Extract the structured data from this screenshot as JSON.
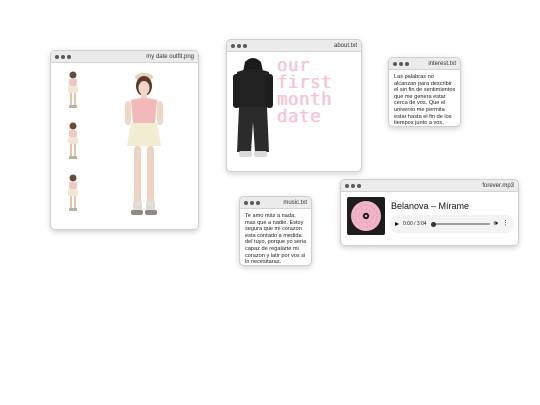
{
  "windows": {
    "outfit": {
      "title": "my date outfit.png"
    },
    "about": {
      "title": "about.txt",
      "pixel_lines": [
        "our",
        "first",
        "month",
        "date"
      ]
    },
    "interest": {
      "title": "interest.txt",
      "text": "Las palabras no alcanzan para describir el sin fin de sentimientos que me genera estar cerca de vos. Que el universo me permita estar hasta el fin de los tiempos junto a vos, hasta el"
    },
    "music": {
      "title": "music.txt",
      "text": "Te amo más a nada, mas que a nadie. Estoy segura que mi corazon esta contado a medida del tuyo, porque yo seria capaz de regalarte mi corazon y latir por vos si lo necesitaras."
    },
    "forever": {
      "title": "forever.mp3",
      "song": "Belanova – Mírame",
      "player": {
        "time": "0:00 / 3:04",
        "progress": 0,
        "state": "paused"
      }
    }
  },
  "colors": {
    "pixel_pink": "#f4c6d4",
    "album_pink": "#f2b4c8",
    "titlebar": "#ebebeb"
  },
  "icons": [
    "window-dots-icon",
    "play-icon",
    "volume-icon",
    "more-options-icon"
  ]
}
